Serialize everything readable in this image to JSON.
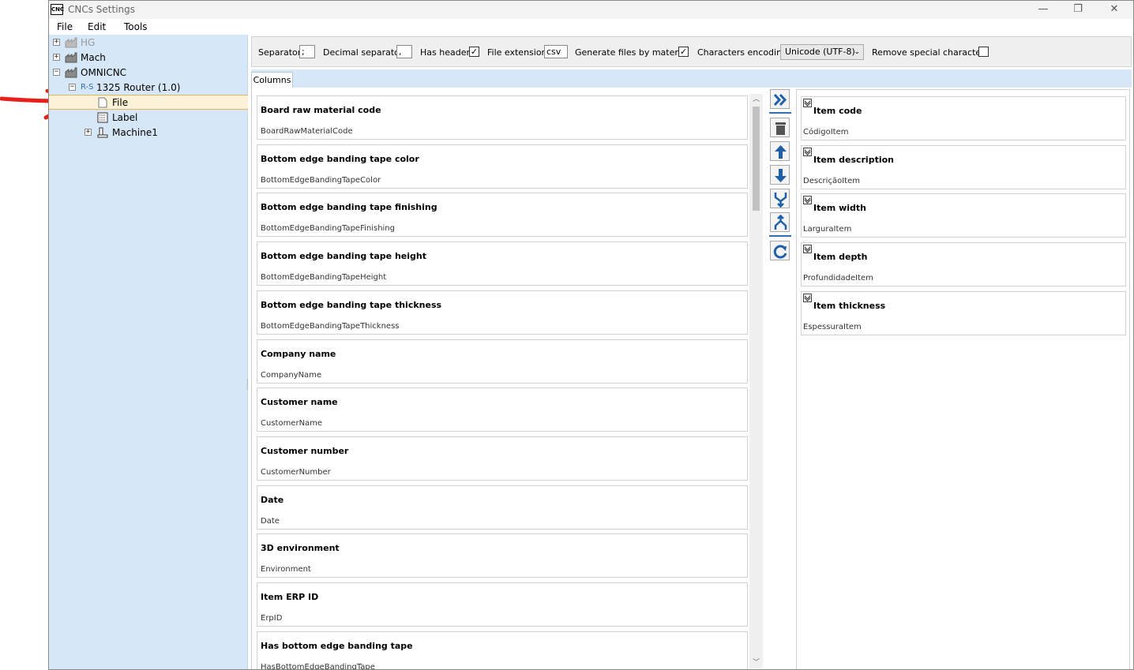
{
  "window": {
    "title": "CNCs Settings",
    "icon_text": "CNC"
  },
  "title_buttons": {
    "minimize": "—",
    "restore": "❐",
    "close": "✕"
  },
  "menu": [
    "File",
    "Edit",
    "Tools"
  ],
  "tree": [
    {
      "label": "HG",
      "expander": "+",
      "icon": "factory-icon",
      "disabled": true
    },
    {
      "label": "Mach",
      "expander": "+",
      "icon": "factory-icon"
    },
    {
      "label": "OMNICNC",
      "expander": "−",
      "icon": "factory-icon"
    },
    {
      "label": "1325 Router (1.0)",
      "expander": "−",
      "icon": "router-icon",
      "icon_text": "R-S"
    },
    {
      "label": "File",
      "icon": "file-icon",
      "selected": true
    },
    {
      "label": "Label",
      "icon": "label-icon"
    },
    {
      "label": "Machine1",
      "expander": "+",
      "icon": "machine-icon"
    }
  ],
  "toolbar": {
    "separator_label": "Separator",
    "separator_value": ";",
    "decimal_label": "Decimal separator",
    "decimal_value": ",",
    "has_header_label": "Has header",
    "has_header_checked": true,
    "file_ext_label": "File extension",
    "file_ext_value": "csv",
    "by_material_label": "Generate files by material",
    "by_material_checked": true,
    "encoding_label": "Characters encoding",
    "encoding_value": "Unicode (UTF-8)",
    "remove_special_label": "Remove special characters",
    "remove_special_checked": false
  },
  "tab": {
    "label": "Columns"
  },
  "available_columns": [
    {
      "title": "Board raw material code",
      "name": "BoardRawMaterialCode"
    },
    {
      "title": "Bottom edge banding tape color",
      "name": "BottomEdgeBandingTapeColor"
    },
    {
      "title": "Bottom edge banding tape finishing",
      "name": "BottomEdgeBandingTapeFinishing"
    },
    {
      "title": "Bottom edge banding tape height",
      "name": "BottomEdgeBandingTapeHeight"
    },
    {
      "title": "Bottom edge banding tape thickness",
      "name": "BottomEdgeBandingTapeThickness"
    },
    {
      "title": "Company name",
      "name": "CompanyName"
    },
    {
      "title": "Customer name",
      "name": "CustomerName"
    },
    {
      "title": "Customer number",
      "name": "CustomerNumber"
    },
    {
      "title": "Date",
      "name": "Date"
    },
    {
      "title": "3D environment",
      "name": "Environment"
    },
    {
      "title": "Item ERP ID",
      "name": "ErpID"
    },
    {
      "title": "Has bottom edge banding tape",
      "name": "HasBottomEdgeBandingTape"
    }
  ],
  "actions": [
    {
      "name": "add-columns-button",
      "icon": "double-chevron-right-icon"
    },
    {
      "name": "delete-column-button",
      "icon": "trash-icon"
    },
    {
      "name": "move-up-button",
      "icon": "arrow-up-icon"
    },
    {
      "name": "move-down-button",
      "icon": "arrow-down-icon"
    },
    {
      "name": "merge-button",
      "icon": "merge-icon"
    },
    {
      "name": "split-button",
      "icon": "split-icon"
    },
    {
      "name": "refresh-button",
      "icon": "refresh-icon"
    }
  ],
  "selected_columns": [
    {
      "title": "Item code",
      "name": "CódigoItem"
    },
    {
      "title": "Item description",
      "name": "DescriçãoItem"
    },
    {
      "title": "Item width",
      "name": "LarguraItem"
    },
    {
      "title": "Item depth",
      "name": "ProfundidadeItem"
    },
    {
      "title": "Item thickness",
      "name": "EspessuraItem"
    }
  ],
  "colors": {
    "sidebar": "#d6e7f7",
    "accent": "#2f6fb5",
    "annotation_arrow": "#e8201a",
    "selection": "#fdf1d8"
  }
}
